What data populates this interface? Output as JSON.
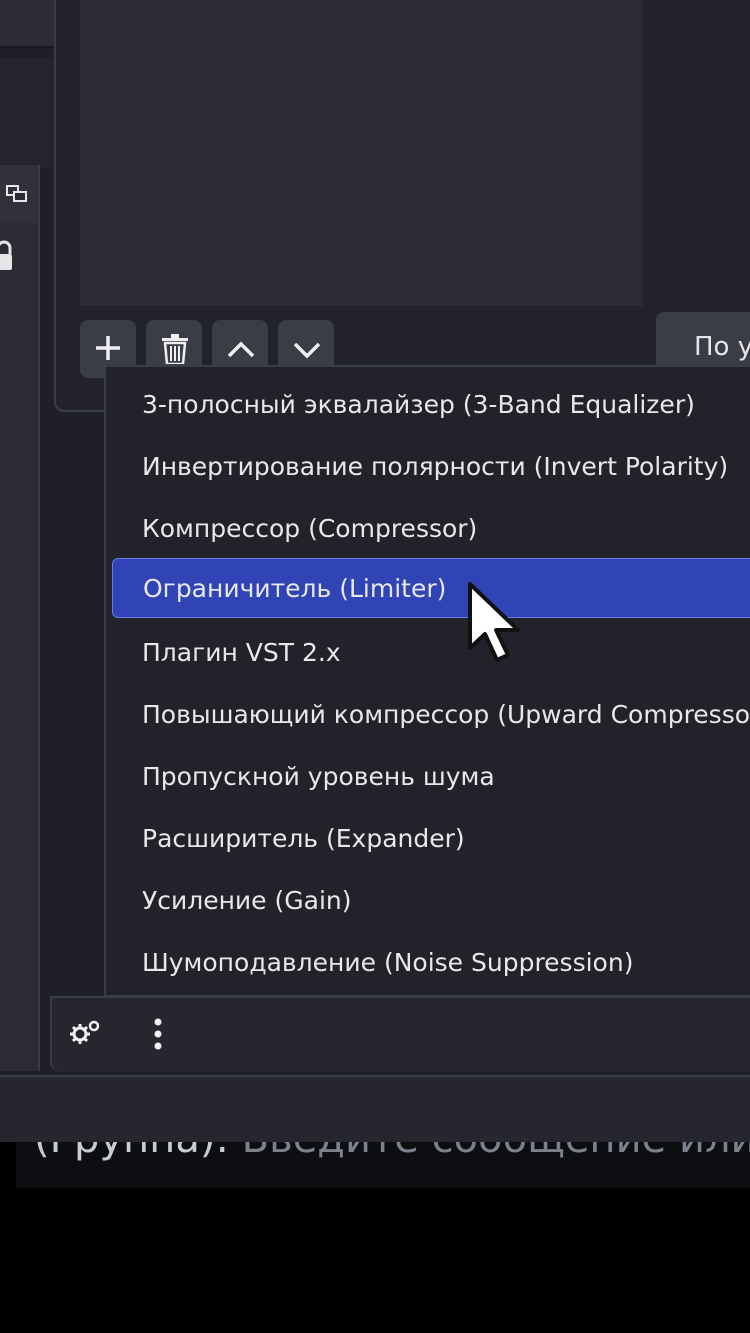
{
  "toolbar": {
    "add_icon": "plus-icon",
    "delete_icon": "trash-icon",
    "up_icon": "chevron-up-icon",
    "down_icon": "chevron-down-icon",
    "right_button_label": "По у"
  },
  "menu": {
    "items": [
      "3-полосный эквалайзер (3-Band Equalizer)",
      "Инвертирование полярности (Invert Polarity)",
      "Компрессор (Compressor)",
      "Ограничитель (Limiter)",
      "Плагин VST 2.x",
      "Повышающий компрессор (Upward Compressor)",
      "Пропускной уровень шума",
      "Расширитель (Expander)",
      "Усиление (Gain)",
      "Шумоподавление (Noise Suppression)"
    ],
    "selected_index": 3,
    "selected_color": "#3044b5"
  },
  "bottom": {
    "gear_icon": "gear-icon",
    "more_icon": "more-vertical-icon"
  },
  "chat": {
    "author": "(Группа):",
    "placeholder": " Введите сообщение или"
  },
  "colors": {
    "background": "#1f2027",
    "panel": "#2a2b33",
    "accent": "#3044b5"
  }
}
